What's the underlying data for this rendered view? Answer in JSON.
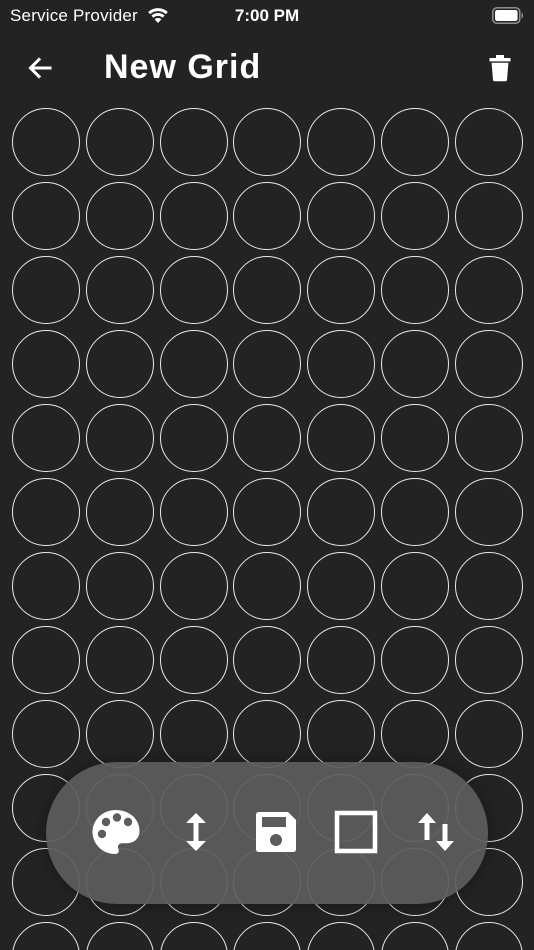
{
  "status_bar": {
    "carrier": "Service Provider",
    "time": "7:00 PM",
    "wifi_icon": "wifi-icon",
    "battery_icon": "battery-full-icon"
  },
  "header": {
    "title": "New Grid",
    "back_icon": "arrow-back-icon",
    "delete_icon": "trash-icon"
  },
  "grid": {
    "columns": 7,
    "rows": 12,
    "bead_outline_color": "#e9e9e9",
    "background_color": "#232323"
  },
  "toolbar": {
    "background_color": "#5c5c5c",
    "buttons": [
      {
        "name": "palette-button",
        "icon": "palette-icon"
      },
      {
        "name": "resize-height-button",
        "icon": "vertical-arrows-icon"
      },
      {
        "name": "save-button",
        "icon": "floppy-disk-icon"
      },
      {
        "name": "frame-button",
        "icon": "square-outline-icon"
      },
      {
        "name": "swap-button",
        "icon": "swap-vertical-icon"
      }
    ]
  }
}
